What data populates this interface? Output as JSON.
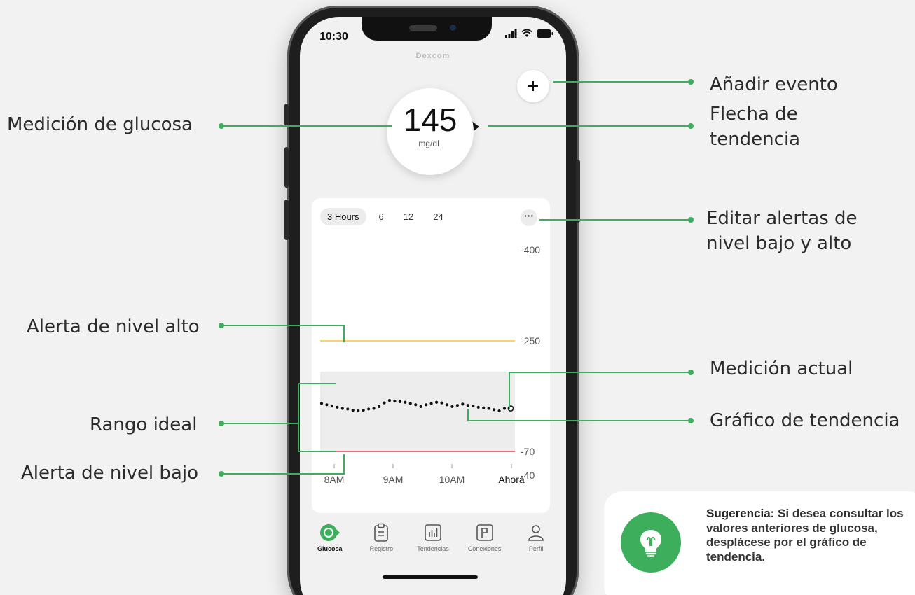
{
  "status_bar": {
    "time": "10:30"
  },
  "app": {
    "brand": "Dexcom"
  },
  "glucose": {
    "value": "145",
    "unit": "mg/dL"
  },
  "chart_controls": {
    "ranges": [
      "3 Hours",
      "6",
      "12",
      "24"
    ],
    "active_range": "3 Hours",
    "more_label": "···"
  },
  "chart_data": {
    "type": "line",
    "title": "",
    "x_ticks": [
      "8AM",
      "9AM",
      "10AM",
      "Ahora"
    ],
    "y_ticks": [
      400,
      250,
      70,
      40
    ],
    "ylim": [
      40,
      400
    ],
    "high_alert": 250,
    "low_alert": 70,
    "target_range": [
      70,
      200
    ],
    "series": [
      {
        "values": [
          148,
          146,
          144,
          142,
          140,
          139,
          137,
          136,
          137,
          139,
          140,
          143,
          149,
          153,
          152,
          151,
          150,
          148,
          146,
          143,
          146,
          148,
          150,
          149,
          146,
          143,
          145,
          147,
          145,
          144,
          142,
          141,
          140,
          138,
          136,
          140
        ]
      }
    ],
    "current_value": 140,
    "high_color": "#f5c542",
    "low_color": "#e8444f",
    "range_fill": "#ededed"
  },
  "tabbar": {
    "items": [
      {
        "label": "Glucosa",
        "icon": "glucose-icon",
        "active": true
      },
      {
        "label": "Registro",
        "icon": "clipboard-icon",
        "active": false
      },
      {
        "label": "Tendencias",
        "icon": "trends-icon",
        "active": false
      },
      {
        "label": "Conexiones",
        "icon": "connections-icon",
        "active": false
      },
      {
        "label": "Perfil",
        "icon": "profile-icon",
        "active": false
      }
    ]
  },
  "annotations": {
    "add_event": "Añadir evento",
    "trend_arrow": "Flecha de tendencia",
    "glucose_reading": "Medición de glucosa",
    "edit_alerts": "Editar alertas de nivel bajo y alto",
    "high_alert": "Alerta de nivel alto",
    "current_reading": "Medición actual",
    "target_range": "Rango ideal",
    "trend_graph": "Gráfico de tendencia",
    "low_alert": "Alerta de nivel bajo"
  },
  "tip": {
    "label": "Sugerencia:",
    "text": " Si desea consultar los valores anteriores de glucosa, desplácese por el gráfico de tendencia."
  },
  "colors": {
    "accent": "#3dae5b",
    "connector": "#3dae5b"
  }
}
